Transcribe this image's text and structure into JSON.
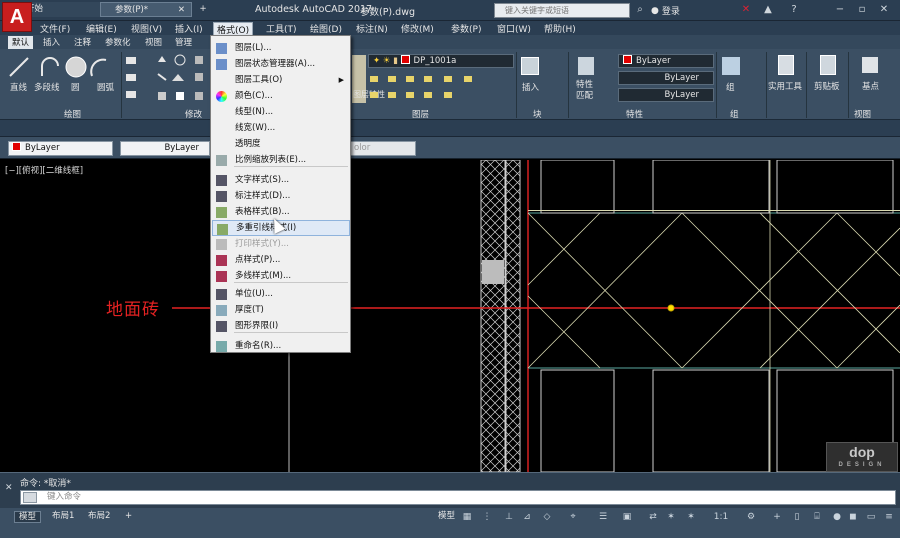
{
  "app": {
    "title": "Autodesk AutoCAD 2017",
    "file": "参数(P).dwg",
    "search_placeholder": "键入关键字或短语",
    "signin": "登录"
  },
  "menubar": {
    "items": [
      "文件(F)",
      "编辑(E)",
      "视图(V)",
      "插入(I)",
      "格式(O)",
      "工具(T)",
      "绘图(D)",
      "标注(N)",
      "修改(M)",
      "参数(P)",
      "窗口(W)",
      "帮助(H)"
    ],
    "active": "格式(O)"
  },
  "ribbon_tabs": {
    "items": [
      "默认",
      "插入",
      "注释",
      "参数化",
      "视图",
      "管理"
    ],
    "active": "默认"
  },
  "ribbon": {
    "draw": {
      "tools": [
        "直线",
        "多段线",
        "圆",
        "圆弧"
      ],
      "title": "绘图"
    },
    "modify_title": "修改",
    "layer_combo": "DP_1001a",
    "layer_tools": "图层特性",
    "layers_title": "图层",
    "insert_label": "插入",
    "block_title": "块",
    "match_label": "特性\n匹配",
    "color_combo": "ByLayer",
    "linetype_combo": "ByLayer",
    "lineweight_combo": "ByLayer",
    "properties_title": "特性",
    "group_label": "组",
    "group_title": "组",
    "utilities_label": "实用工具",
    "clipboard_label": "剪贴板",
    "base_label": "基点",
    "view_title": "视图"
  },
  "file_tabs": [
    "开始",
    "参数(P)*"
  ],
  "propbar": {
    "color": "ByLayer",
    "linetype": "ByLayer",
    "plotstyle": "olor"
  },
  "viewport_label": "[−][俯视][二维线框]",
  "canvas_text": "地面砖",
  "brand": {
    "main": "dop",
    "sub": "DESIGN"
  },
  "command": {
    "history": "命令: *取消*",
    "prompt": "键入命令"
  },
  "status_tabs": [
    "模型",
    "布局1",
    "布局2"
  ],
  "status": {
    "model_label": "模型",
    "scale": "1:1"
  },
  "dropdown": {
    "items": [
      {
        "label": "图层(L)...",
        "icon": "layers-icon"
      },
      {
        "label": "图层状态管理器(A)...",
        "icon": "layer-state-icon"
      },
      {
        "label": "图层工具(O)",
        "icon": "none",
        "submenu": true
      },
      {
        "label": "颜色(C)...",
        "icon": "color-wheel-icon"
      },
      {
        "label": "线型(N)...",
        "icon": "none"
      },
      {
        "label": "线宽(W)...",
        "icon": "none"
      },
      {
        "label": "透明度",
        "icon": "none"
      },
      {
        "label": "比例缩放列表(E)...",
        "icon": "scale-list-icon"
      },
      {
        "label": "文字样式(S)...",
        "icon": "text-style-icon"
      },
      {
        "label": "标注样式(D)...",
        "icon": "dim-style-icon"
      },
      {
        "label": "表格样式(B)...",
        "icon": "table-style-icon"
      },
      {
        "label": "多重引线样式(I)",
        "icon": "mleader-style-icon",
        "highlighted": true
      },
      {
        "label": "打印样式(Y)...",
        "icon": "plot-style-icon",
        "disabled": true
      },
      {
        "label": "点样式(P)...",
        "icon": "point-style-icon"
      },
      {
        "label": "多线样式(M)...",
        "icon": "mline-style-icon"
      },
      {
        "label": "单位(U)...",
        "icon": "units-icon"
      },
      {
        "label": "厚度(T)",
        "icon": "thickness-icon"
      },
      {
        "label": "图形界限(I)",
        "icon": "limits-icon"
      },
      {
        "label": "重命名(R)...",
        "icon": "rename-icon"
      }
    ]
  },
  "colors": {
    "accent_red": "#e42222",
    "title_bar": "#2b3e52",
    "ribbon": "#3b4f63",
    "canvas": "#000000"
  }
}
